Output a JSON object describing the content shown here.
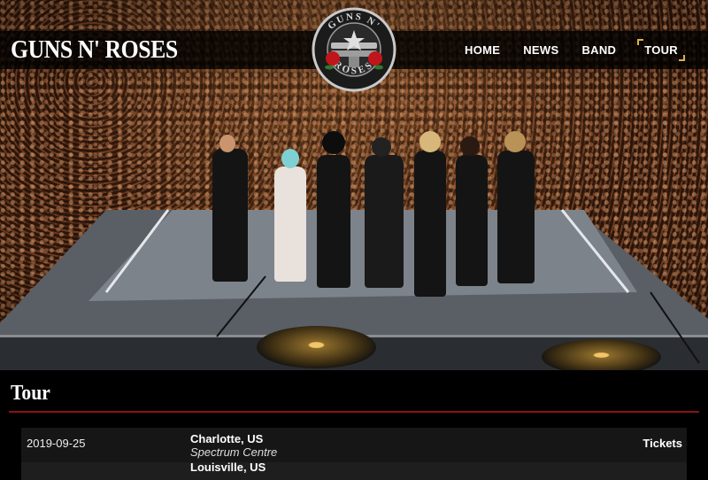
{
  "header": {
    "brand": "GUNS N' ROSES",
    "nav": [
      "HOME",
      "NEWS",
      "BAND",
      "TOUR"
    ],
    "active_nav": "TOUR"
  },
  "logo": {
    "top_text": "GUNS N'",
    "bottom_text": "ROSES",
    "colors": {
      "ring": "#c9c9c9",
      "rose": "#c0161b",
      "leaf": "#2c7a2c"
    }
  },
  "tour": {
    "title": "Tour",
    "events": [
      {
        "date": "2019-09-25",
        "city": "Charlotte, US",
        "venue": "Spectrum Centre",
        "tickets_label": "Tickets"
      },
      {
        "date": "",
        "city": "Louisville, US",
        "venue": "",
        "tickets_label": ""
      }
    ]
  },
  "colors": {
    "accent": "#d8b24a",
    "divider": "#8a1212"
  }
}
